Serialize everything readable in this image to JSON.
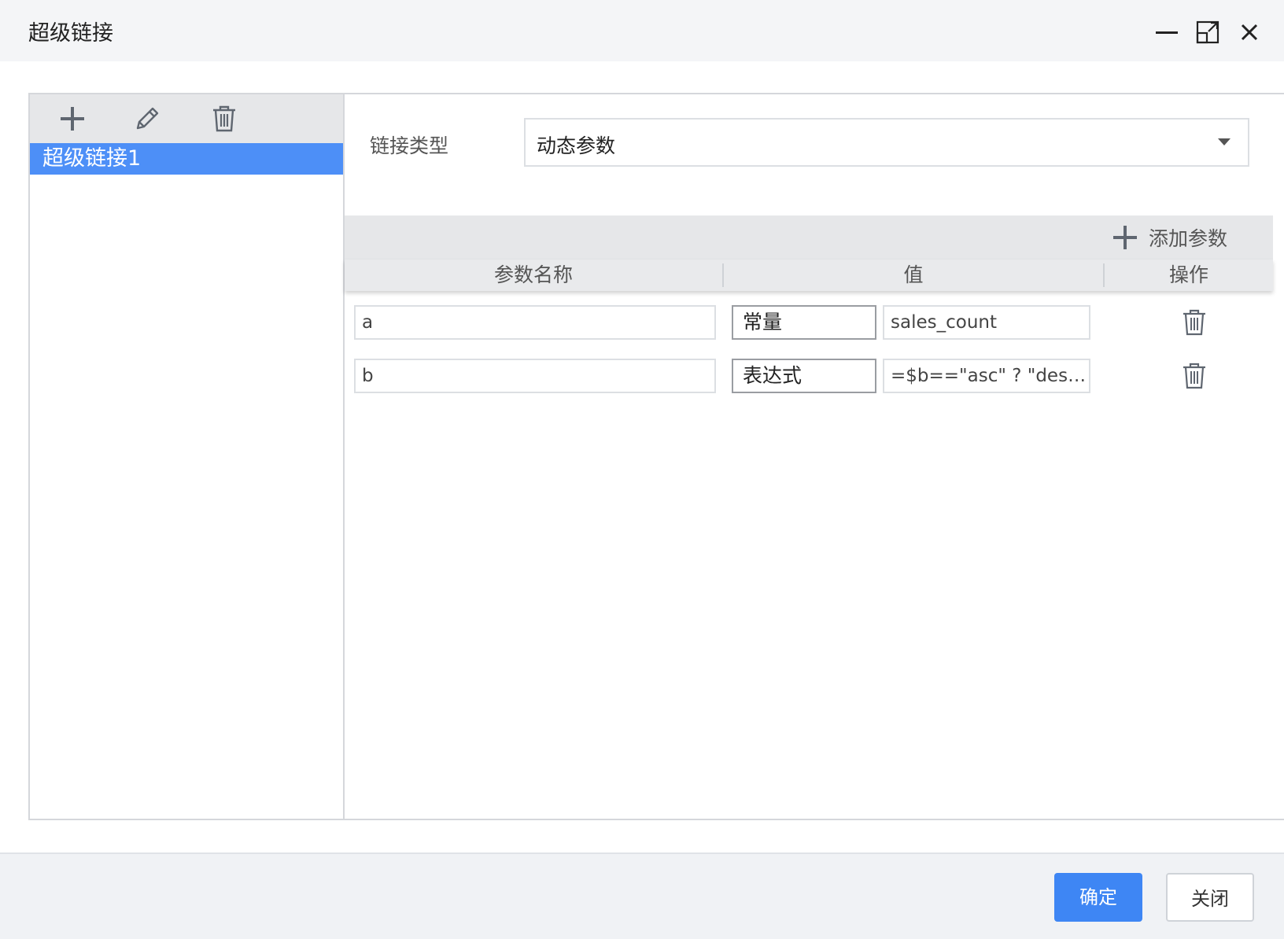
{
  "dialog": {
    "title": "超级链接",
    "window_controls": {
      "minimize_icon": "minimize-icon",
      "maximize_icon": "maximize-icon",
      "close_icon": "close-icon"
    }
  },
  "sidebar": {
    "toolbar_icons": [
      "plus-icon",
      "pencil-icon",
      "trash-icon"
    ],
    "items": [
      {
        "label": "超级链接1",
        "selected": true
      }
    ]
  },
  "detail": {
    "link_type_label": "链接类型",
    "link_type_value": "动态参数",
    "add_param_label": "添加参数",
    "table": {
      "headers": [
        "参数名称",
        "值",
        "操作"
      ],
      "rows": [
        {
          "name": "a",
          "type": "常量",
          "value": "sales_count"
        },
        {
          "name": "b",
          "type": "表达式",
          "value": "=$b==\"asc\" ? \"desc\" : \"asc\""
        }
      ]
    }
  },
  "footer": {
    "ok_label": "确定",
    "close_label": "关闭"
  },
  "colors": {
    "accent": "#3e86f4",
    "selected_item": "#4d8ff7",
    "toolbar_bg": "#e6e7e9",
    "footer_bg": "#f0f2f5"
  }
}
